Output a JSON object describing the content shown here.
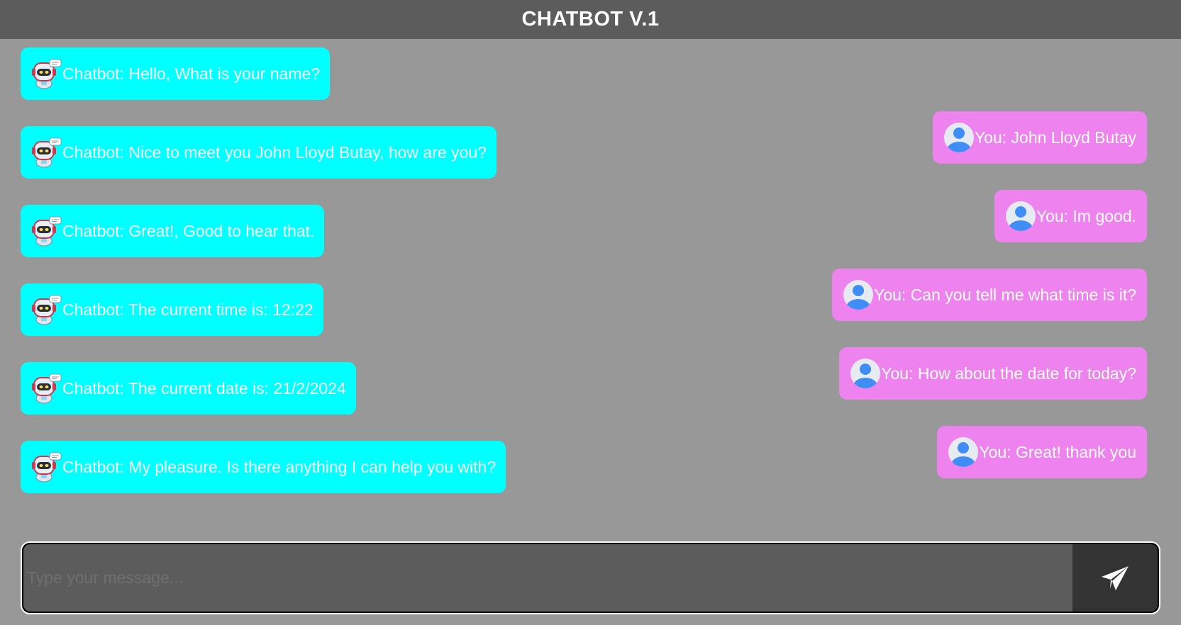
{
  "header": {
    "title": "CHATBOT V.1"
  },
  "messages": {
    "bot": [
      "Chatbot: Hello, What is your name?",
      "Chatbot: Nice to meet you John Lloyd Butay, how are you?",
      "Chatbot: Great!, Good to hear that.",
      "Chatbot: The current time is: 12:22",
      "Chatbot: The current date is: 21/2/2024",
      "Chatbot: My pleasure. Is there anything I can help you with?"
    ],
    "user": [
      "You: John Lloyd Butay",
      "You: Im good.",
      "You: Can you tell me what time is it?",
      "You: How about the date for today?",
      "You: Great! thank you"
    ]
  },
  "composer": {
    "placeholder": "Type your message...",
    "value": "",
    "send_icon": "paper-plane-icon"
  },
  "colors": {
    "background": "#989898",
    "header": "#5c5c5c",
    "bot_bubble": "#00ffff",
    "user_bubble": "#ee82ee",
    "input_bg": "#5c5c5c",
    "send_bg": "#333333",
    "text": "#ffffff"
  }
}
